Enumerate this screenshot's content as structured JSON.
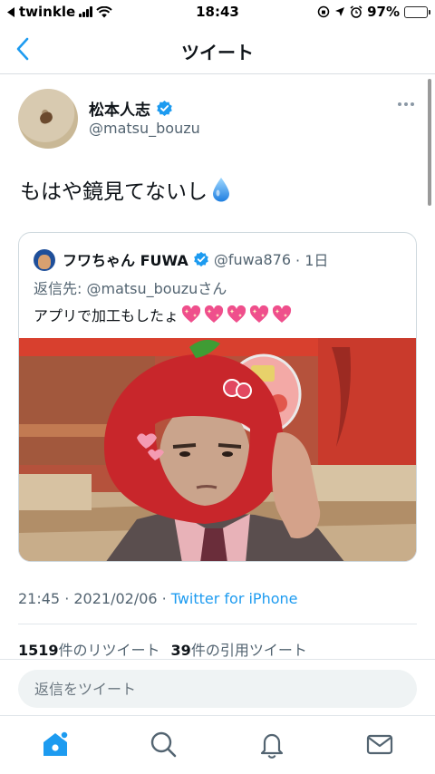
{
  "status_bar": {
    "back_app": "twinkle",
    "time": "18:43",
    "battery": "97%",
    "battery_level": 0.97
  },
  "nav": {
    "title": "ツイート"
  },
  "tweet": {
    "author_name": "松本人志",
    "author_handle": "@matsu_bouzu",
    "text": "もはや鏡見てないし",
    "timestamp": "21:45 · 2021/02/06",
    "source": "Twitter for iPhone",
    "retweets_count": "1519",
    "retweets_label": "件のリツイート",
    "quotes_count": "39",
    "quotes_label": "件の引用ツイート"
  },
  "quoted": {
    "author_name": "フワちゃん FUWA",
    "author_handle": "@fuwa876",
    "time": "· 1日",
    "reply_prefix": "返信先: ",
    "reply_handle": "@matsu_bouzu",
    "reply_suffix": "さん",
    "text": "アプリで加工もしたょ"
  },
  "reply_box": {
    "placeholder": "返信をツイート"
  },
  "icons": {
    "back": "chevron-left-icon",
    "verified": "verified-badge-icon",
    "more": "more-icon",
    "droplet": "droplet-emoji-icon",
    "heart": "sparkling-heart-emoji-icon",
    "home": "home-icon",
    "search": "search-icon",
    "notifications": "bell-icon",
    "messages": "mail-icon"
  },
  "colors": {
    "accent": "#1d9bf0",
    "secondary_text": "#536471",
    "battery_green": "#34c759"
  }
}
